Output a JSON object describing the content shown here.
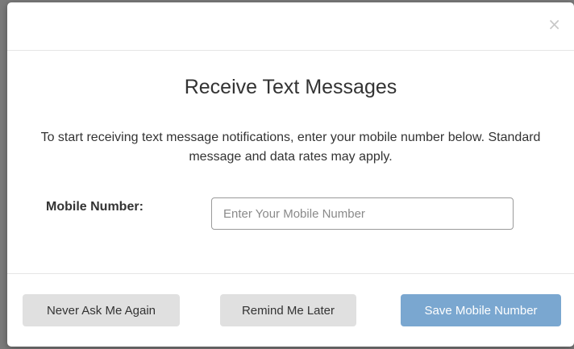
{
  "modal": {
    "close_symbol": "×",
    "title": "Receive Text Messages",
    "description": "To start receiving text message notifications, enter your mobile number below. Standard message and data rates may apply.",
    "mobile_label": "Mobile Number:",
    "mobile_placeholder": "Enter Your Mobile Number",
    "mobile_value": ""
  },
  "footer": {
    "never_label": "Never Ask Me Again",
    "remind_label": "Remind Me Later",
    "save_label": "Save Mobile Number"
  },
  "colors": {
    "primary_button": "#7aa7d0",
    "secondary_button": "#e0e0e0",
    "backdrop": "#7a7a7a"
  },
  "icons": {
    "close": "close-icon"
  }
}
